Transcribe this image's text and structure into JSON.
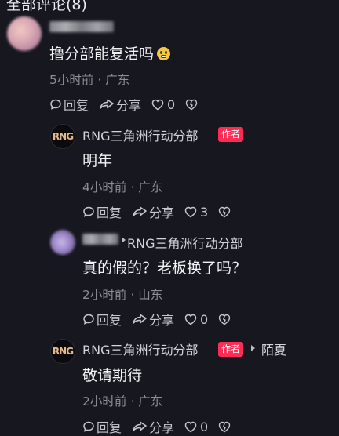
{
  "header": {
    "title": "全部评论(8)"
  },
  "comments": [
    {
      "content": "撸分部能复活吗",
      "emoji": "grimacing-emoji",
      "time": "5小时前",
      "location": "广东",
      "reply_label": "回复",
      "share_label": "分享",
      "likes": "0"
    },
    {
      "author": "RNG三角洲行动分部",
      "author_tag": "作者",
      "content": "明年",
      "time": "4小时前",
      "location": "广东",
      "reply_label": "回复",
      "share_label": "分享",
      "likes": "3"
    },
    {
      "reply_to": "RNG三角洲行动分部",
      "content": "真的假的？老板换了吗？",
      "time": "2小时前",
      "location": "山东",
      "reply_label": "回复",
      "share_label": "分享",
      "likes": "0"
    },
    {
      "author": "RNG三角洲行动分部",
      "author_tag": "作者",
      "reply_to": "陌夏",
      "content": "敬请期待",
      "time": "2小时前",
      "location": "广东",
      "reply_label": "回复",
      "share_label": "分享",
      "likes": "0"
    }
  ],
  "separator": "·",
  "logo_text": "RNG",
  "colors": {
    "background": "#16171f",
    "author_tag": "#fe2c55",
    "meta": "#8e8e96"
  }
}
